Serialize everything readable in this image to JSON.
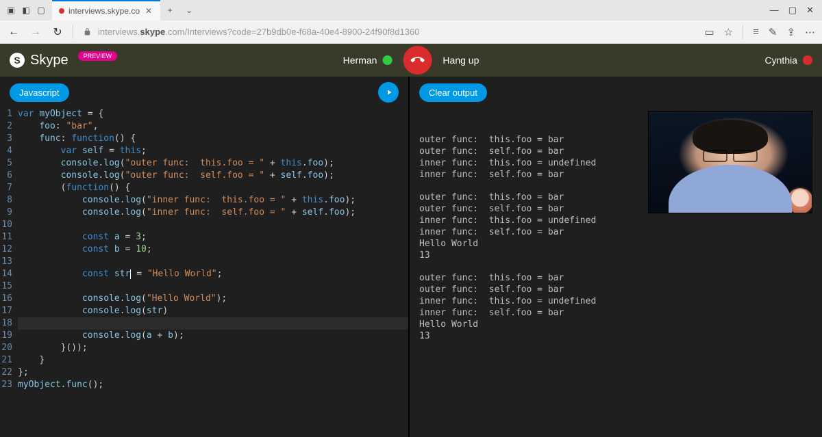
{
  "browser": {
    "tab_title": "interviews.skype.co",
    "url": "interviews.skype.com/Interviews?code=27b9db0e-f68a-40e4-8900-24f90f8d1360",
    "url_display_prefix": "interviews.",
    "url_display_bold": "skype",
    "url_display_suffix": ".com/Interviews?code=27b9db0e-f68a-40e4-8900-24f90f8d1360",
    "new_tab": "+",
    "more_tabs": "⌄",
    "win_min": "—",
    "win_max": "▢",
    "win_close": "✕"
  },
  "header": {
    "app_name": "Skype",
    "preview_badge": "PREVIEW",
    "participant_left": {
      "name": "Herman",
      "status_color": "#2ecc40"
    },
    "hangup": "Hang up",
    "participant_right": {
      "name": "Cynthia",
      "status_color": "#d92c2c"
    }
  },
  "editor": {
    "language_button": "Javascript",
    "lines": [
      {
        "n": 1,
        "html": "<span class='tk-kw'>var</span> <span class='tk-id'>myObject</span> <span class='tk-punc'>= {</span>"
      },
      {
        "n": 2,
        "html": "    <span class='tk-prop'>foo</span><span class='tk-punc'>:</span> <span class='tk-str'>\"bar\"</span><span class='tk-punc'>,</span>"
      },
      {
        "n": 3,
        "html": "    <span class='tk-prop'>func</span><span class='tk-punc'>:</span> <span class='tk-fn'>function</span><span class='tk-punc'>() {</span>"
      },
      {
        "n": 4,
        "html": "        <span class='tk-kw'>var</span> <span class='tk-id'>self</span> <span class='tk-punc'>=</span> <span class='tk-this'>this</span><span class='tk-punc'>;</span>"
      },
      {
        "n": 5,
        "html": "        <span class='tk-id'>console</span><span class='tk-punc'>.</span><span class='tk-id'>log</span><span class='tk-punc'>(</span><span class='tk-str'>\"outer func:  this.foo = \"</span> <span class='tk-punc'>+</span> <span class='tk-this'>this</span><span class='tk-punc'>.</span><span class='tk-id'>foo</span><span class='tk-punc'>);</span>"
      },
      {
        "n": 6,
        "html": "        <span class='tk-id'>console</span><span class='tk-punc'>.</span><span class='tk-id'>log</span><span class='tk-punc'>(</span><span class='tk-str'>\"outer func:  self.foo = \"</span> <span class='tk-punc'>+</span> <span class='tk-id'>self</span><span class='tk-punc'>.</span><span class='tk-id'>foo</span><span class='tk-punc'>);</span>"
      },
      {
        "n": 7,
        "html": "        <span class='tk-punc'>(</span><span class='tk-fn'>function</span><span class='tk-punc'>() {</span>"
      },
      {
        "n": 8,
        "html": "            <span class='tk-id'>console</span><span class='tk-punc'>.</span><span class='tk-id'>log</span><span class='tk-punc'>(</span><span class='tk-str'>\"inner func:  this.foo = \"</span> <span class='tk-punc'>+</span> <span class='tk-this'>this</span><span class='tk-punc'>.</span><span class='tk-id'>foo</span><span class='tk-punc'>);</span>"
      },
      {
        "n": 9,
        "html": "            <span class='tk-id'>console</span><span class='tk-punc'>.</span><span class='tk-id'>log</span><span class='tk-punc'>(</span><span class='tk-str'>\"inner func:  self.foo = \"</span> <span class='tk-punc'>+</span> <span class='tk-id'>self</span><span class='tk-punc'>.</span><span class='tk-id'>foo</span><span class='tk-punc'>);</span>"
      },
      {
        "n": 10,
        "html": " "
      },
      {
        "n": 11,
        "html": "            <span class='tk-kw'>const</span> <span class='tk-id'>a</span> <span class='tk-punc'>=</span> <span class='tk-num'>3</span><span class='tk-punc'>;</span>"
      },
      {
        "n": 12,
        "html": "            <span class='tk-kw'>const</span> <span class='tk-id'>b</span> <span class='tk-punc'>=</span> <span class='tk-num'>10</span><span class='tk-punc'>;</span>"
      },
      {
        "n": 13,
        "html": " "
      },
      {
        "n": 14,
        "html": "            <span class='tk-kw'>const</span> <span class='tk-id'>str</span><span class='cursor'></span> <span class='tk-punc'>=</span> <span class='tk-str'>\"Hello World\"</span><span class='tk-punc'>;</span>"
      },
      {
        "n": 15,
        "html": " "
      },
      {
        "n": 16,
        "html": "            <span class='tk-id'>console</span><span class='tk-punc'>.</span><span class='tk-id'>log</span><span class='tk-punc'>(</span><span class='tk-str'>\"Hello World\"</span><span class='tk-punc'>);</span>"
      },
      {
        "n": 17,
        "html": "            <span class='tk-id'>console</span><span class='tk-punc'>.</span><span class='tk-id'>log</span><span class='tk-punc'>(</span><span class='tk-id'>str</span><span class='tk-punc'>)</span>"
      },
      {
        "n": 18,
        "html": " ",
        "hl": true
      },
      {
        "n": 19,
        "html": "            <span class='tk-id'>console</span><span class='tk-punc'>.</span><span class='tk-id'>log</span><span class='tk-punc'>(</span><span class='tk-id'>a</span> <span class='tk-punc'>+</span> <span class='tk-id'>b</span><span class='tk-punc'>);</span>"
      },
      {
        "n": 20,
        "html": "        <span class='tk-punc'>}());</span>"
      },
      {
        "n": 21,
        "html": "    <span class='tk-punc'>}</span>"
      },
      {
        "n": 22,
        "html": "<span class='tk-punc'>};</span>"
      },
      {
        "n": 23,
        "html": "<span class='tk-id'>myObject</span><span class='tk-punc'>.</span><span class='tk-id'>func</span><span class='tk-punc'>();</span>"
      }
    ]
  },
  "output": {
    "clear_button": "Clear output",
    "blocks": [
      "outer func:  this.foo = bar\nouter func:  self.foo = bar\ninner func:  this.foo = undefined\ninner func:  self.foo = bar",
      "outer func:  this.foo = bar\nouter func:  self.foo = bar\ninner func:  this.foo = undefined\ninner func:  self.foo = bar\nHello World\n13",
      "outer func:  this.foo = bar\nouter func:  self.foo = bar\ninner func:  this.foo = undefined\ninner func:  self.foo = bar\nHello World\n13"
    ]
  }
}
